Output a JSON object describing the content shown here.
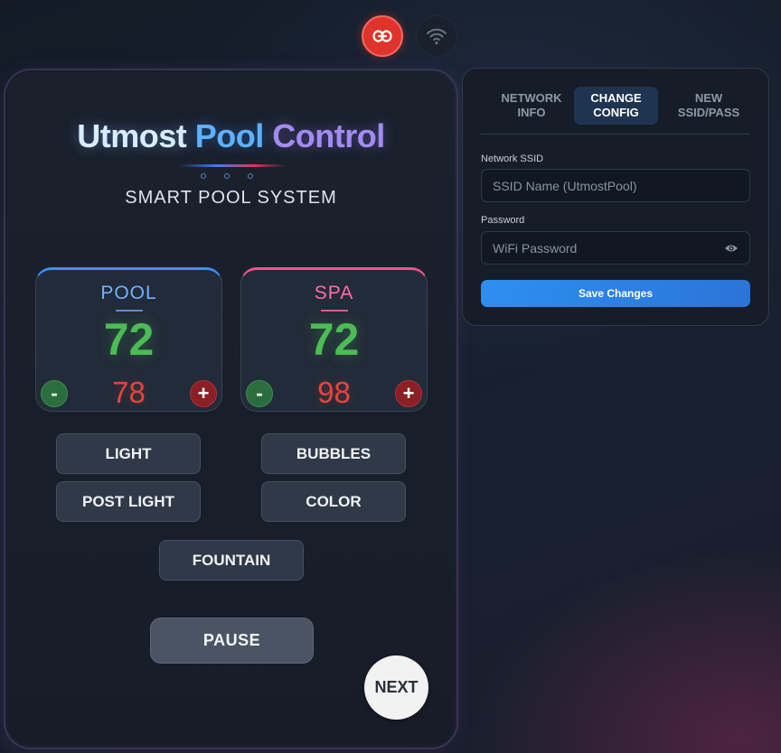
{
  "app": {
    "title_part1": "Utmost",
    "title_part2": "Pool",
    "title_part3": "Control",
    "subtitle": "SMART POOL SYSTEM"
  },
  "pool": {
    "label": "POOL",
    "current_temp": "72",
    "set_temp": "78",
    "minus_label": "-",
    "plus_label": "+"
  },
  "spa": {
    "label": "SPA",
    "current_temp": "72",
    "set_temp": "98",
    "minus_label": "-",
    "plus_label": "+"
  },
  "controls": {
    "light": "LIGHT",
    "bubbles": "BUBBLES",
    "post_light": "POST LIGHT",
    "color": "COLOR",
    "fountain": "FOUNTAIN",
    "pause": "PAUSE",
    "next": "NEXT"
  },
  "network": {
    "tabs": [
      {
        "label_line1": "NETWORK",
        "label_line2": "INFO",
        "active": false
      },
      {
        "label_line1": "CHANGE",
        "label_line2": "CONFIG",
        "active": true
      },
      {
        "label_line1": "NEW",
        "label_line2": "SSID/PASS",
        "active": false
      }
    ],
    "ssid_label": "Network SSID",
    "ssid_placeholder": "SSID Name (UtmostPool)",
    "ssid_value": "",
    "password_label": "Password",
    "password_placeholder": "WiFi Password",
    "password_value": "",
    "save_label": "Save Changes"
  },
  "icons": {
    "connection": "link-icon",
    "wifi": "wifi-icon",
    "password_toggle": "eye-icon"
  },
  "colors": {
    "accent_blue": "#2d8ff0",
    "pool_accent": "#3d8eff",
    "spa_accent": "#ff4f8b",
    "current_temp": "#4cbc55",
    "set_temp": "#e5453d",
    "link_active": "#e0332b"
  }
}
